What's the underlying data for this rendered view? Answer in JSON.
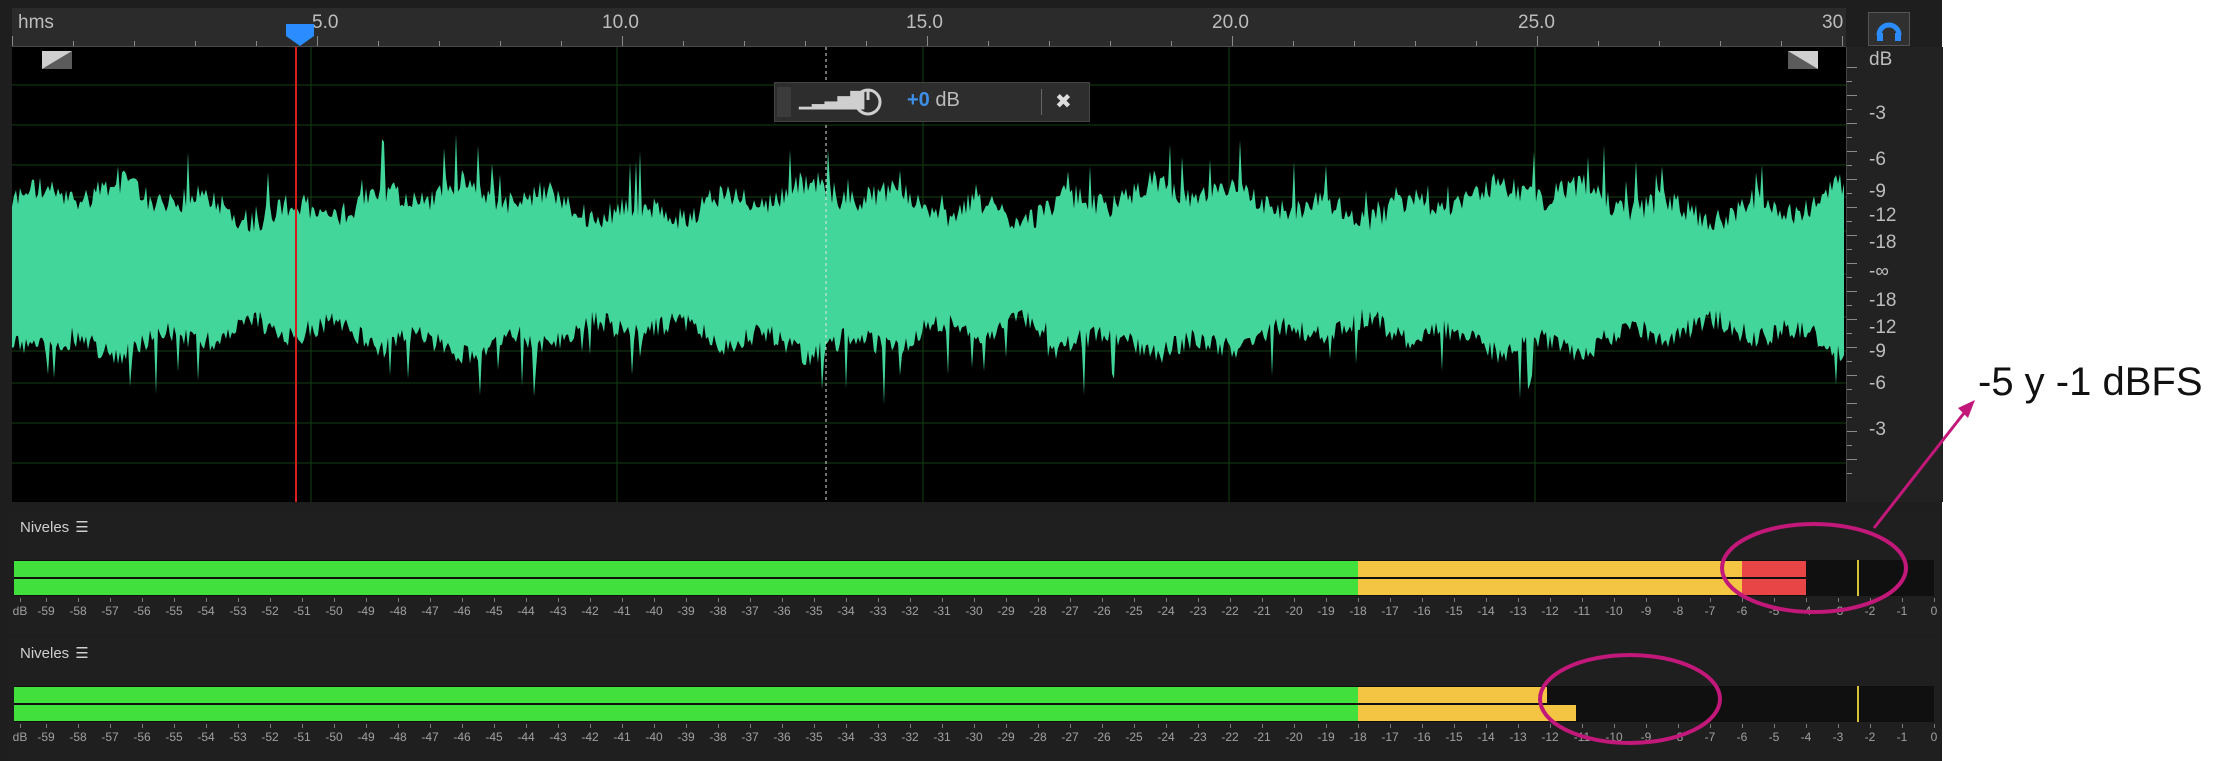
{
  "ruler": {
    "unit": "hms",
    "labels": [
      "5.0",
      "10.0",
      "15.0",
      "20.0",
      "25.0",
      "30"
    ]
  },
  "db_scale": {
    "header": "dB",
    "labels": [
      "-3",
      "-6",
      "-9",
      "-12",
      "-18",
      "-∞",
      "-18",
      "-12",
      "-9",
      "-6",
      "-3"
    ]
  },
  "hud": {
    "volume_icon": "▁▂▃▅▇",
    "gain_sign_value": "+0",
    "gain_unit": " dB",
    "pin_icon": "✖"
  },
  "panels": [
    {
      "title": "Niveles",
      "menu": "☰"
    },
    {
      "title": "Niveles",
      "menu": "☰"
    }
  ],
  "meter_scale": [
    "dB",
    "-59",
    "-58",
    "-57",
    "-56",
    "-55",
    "-54",
    "-53",
    "-52",
    "-51",
    "-50",
    "-49",
    "-48",
    "-47",
    "-46",
    "-45",
    "-44",
    "-43",
    "-42",
    "-41",
    "-40",
    "-39",
    "-38",
    "-37",
    "-36",
    "-35",
    "-34",
    "-33",
    "-32",
    "-31",
    "-30",
    "-29",
    "-28",
    "-27",
    "-26",
    "-25",
    "-24",
    "-23",
    "-22",
    "-21",
    "-20",
    "-19",
    "-18",
    "-17",
    "-16",
    "-15",
    "-14",
    "-13",
    "-12",
    "-11",
    "-10",
    "-9",
    "-8",
    "-7",
    "-6",
    "-5",
    "-4",
    "-3",
    "-2",
    "-1",
    "0"
  ],
  "meters": [
    {
      "levels_db": [
        -4.0,
        -4.0
      ],
      "peak_db": -2.4
    },
    {
      "levels_db": [
        -12.1,
        -11.2
      ],
      "peak_db": -2.4
    }
  ],
  "annotation": {
    "text": "-5 y -1 dBFS",
    "color": "#c2187a"
  },
  "colors": {
    "waveform": "#43d69b",
    "playhead": "#d21f1f",
    "meter_green": "#42e03d",
    "meter_yellow": "#f4c542",
    "meter_red": "#e84646"
  }
}
